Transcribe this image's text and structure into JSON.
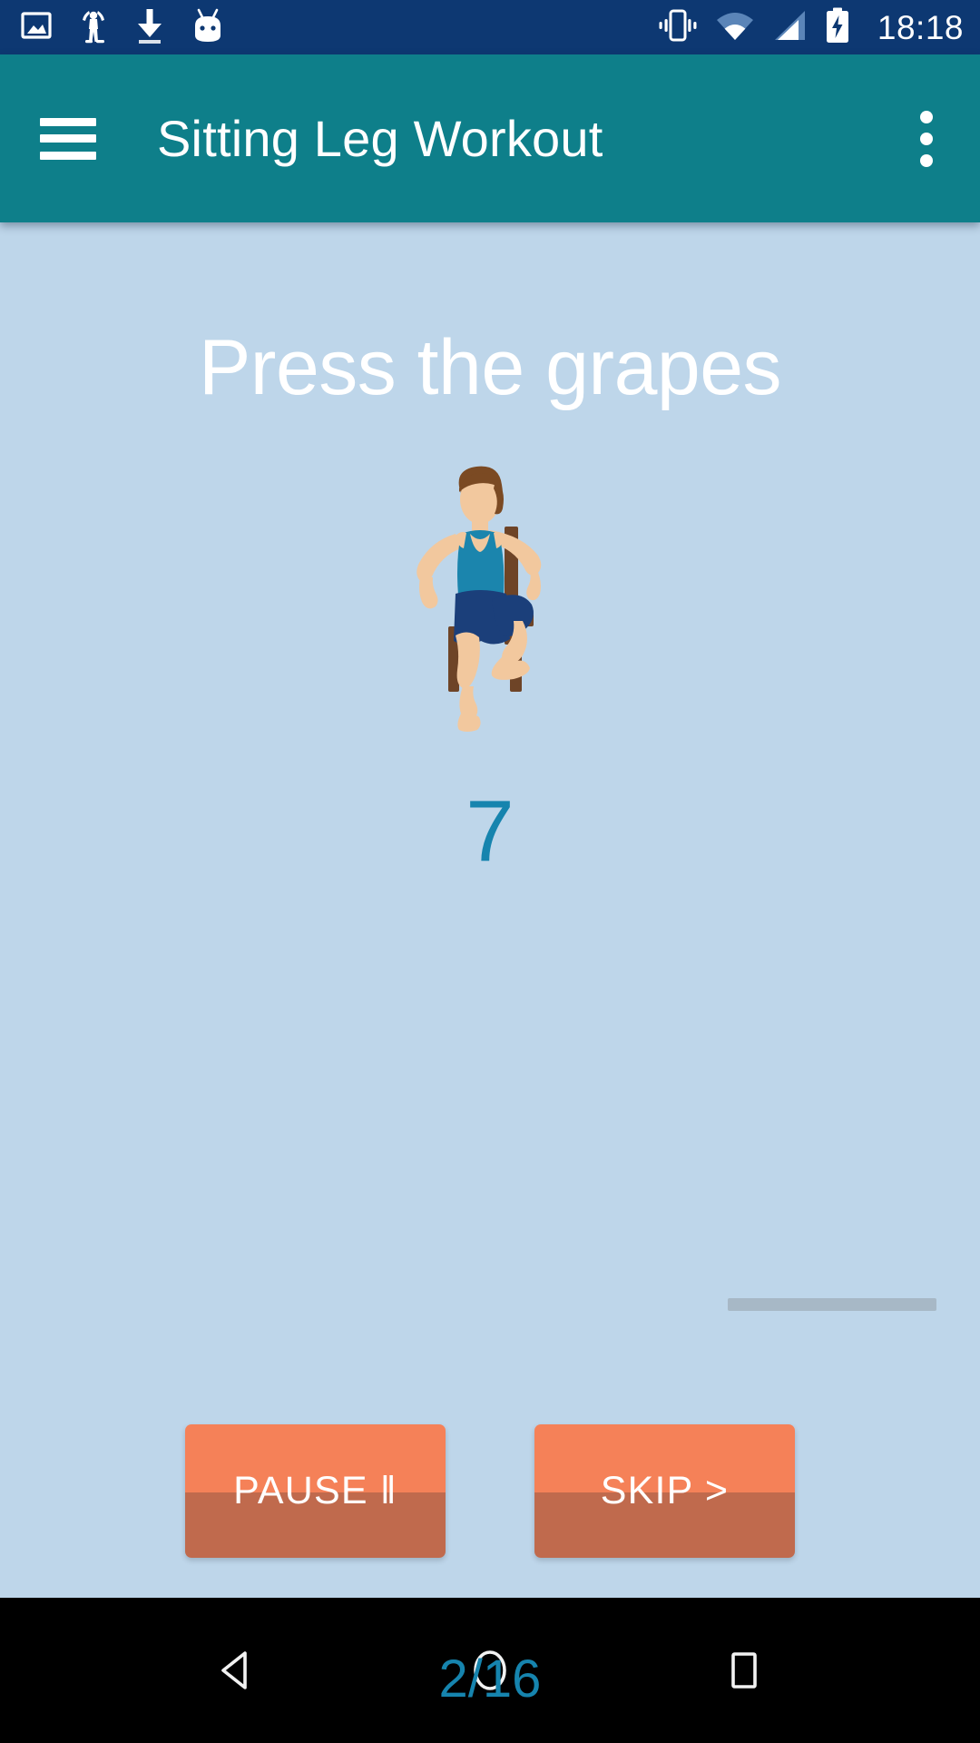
{
  "status_bar": {
    "time": "18:18",
    "background": "#0d3872",
    "left_icons": [
      {
        "name": "image-icon",
        "label": "Screenshot"
      },
      {
        "name": "stretching-person-icon",
        "label": "Workout app notification"
      },
      {
        "name": "download-icon",
        "label": "Download"
      },
      {
        "name": "android-head-icon",
        "label": "Android system"
      }
    ],
    "right_icons": [
      {
        "name": "vibrate-icon",
        "label": "Vibrate mode"
      },
      {
        "name": "wifi-icon",
        "label": "Wi-Fi signal"
      },
      {
        "name": "cellular-signal-icon",
        "label": "Cellular signal"
      },
      {
        "name": "battery-charging-icon",
        "label": "Battery charging"
      }
    ]
  },
  "app_bar": {
    "title": "Sitting Leg Workout",
    "background": "#0e7f8a",
    "menu_icon": "hamburger-menu-icon",
    "overflow_icon": "more-vert-icon"
  },
  "main": {
    "background": "#bed6ea",
    "exercise_title": "Press the grapes",
    "illustration": "seated-leg-exercise-figure",
    "timer_seconds": "7",
    "timer_color": "#1684ae",
    "step_counter": "2/16",
    "step_counter_color": "#1684ae",
    "progress_bar": {
      "name": "scroll-indicator",
      "color": "#a7b8c6"
    }
  },
  "controls": {
    "pause_label": "PAUSE ‖",
    "skip_label": "SKIP >",
    "button_top_color": "#f58158",
    "button_bottom_color": "#c06a4d",
    "button_text_color": "#ffffff"
  },
  "nav_bar": {
    "background": "#000000",
    "back_label": "Back",
    "home_label": "Home",
    "recents_label": "Recent apps"
  }
}
